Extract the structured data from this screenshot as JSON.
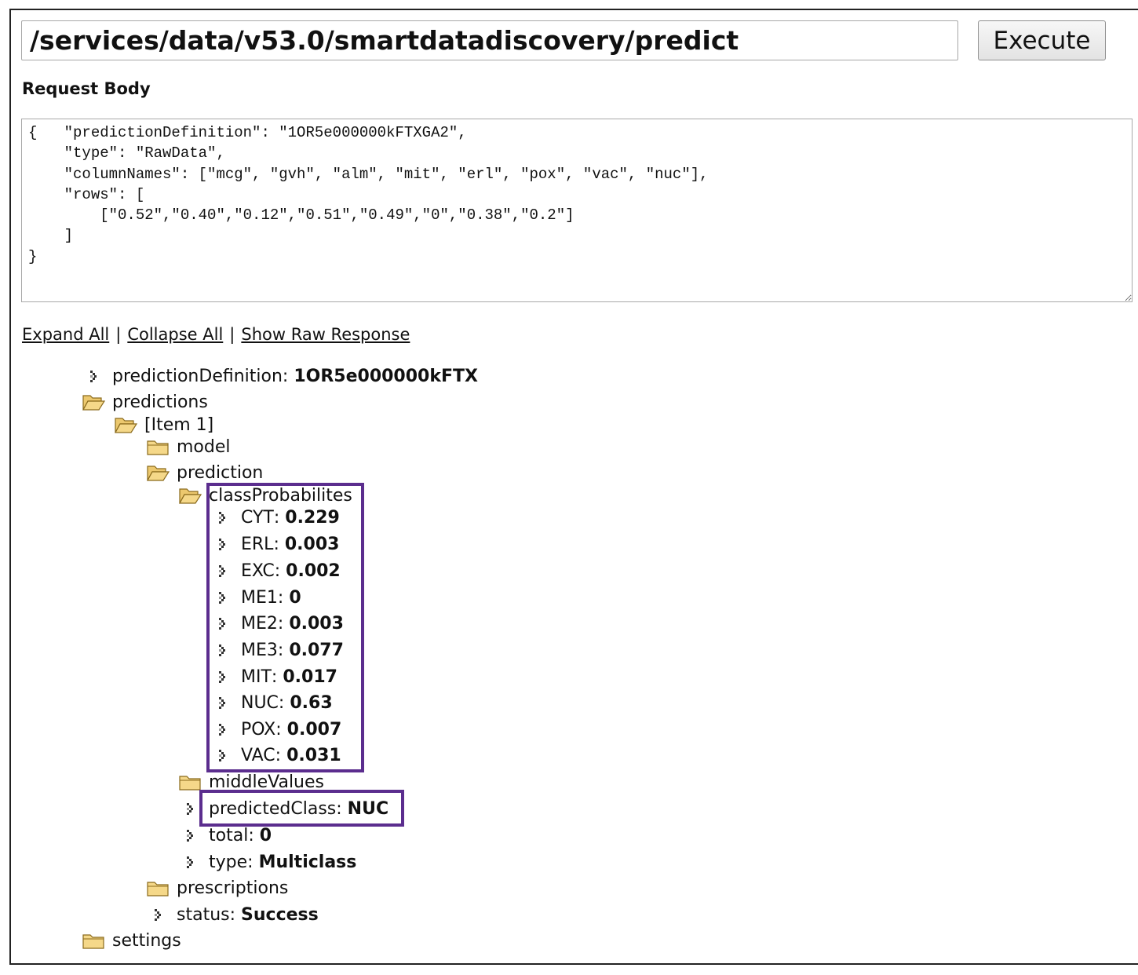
{
  "request": {
    "url": "/services/data/v53.0/smartdatadiscovery/predict",
    "execute_label": "Execute",
    "body_label": "Request Body",
    "body_text": "{   \"predictionDefinition\": \"1OR5e000000kFTXGA2\",\n    \"type\": \"RawData\",\n    \"columnNames\": [\"mcg\", \"gvh\", \"alm\", \"mit\", \"erl\", \"pox\", \"vac\", \"nuc\"],\n    \"rows\": [\n        [\"0.52\",\"0.40\",\"0.12\",\"0.51\",\"0.49\",\"0\",\"0.38\",\"0.2\"]\n    ]\n}"
  },
  "links": {
    "expand_all": "Expand All",
    "collapse_all": "Collapse All",
    "show_raw": "Show Raw Response",
    "separator": "|"
  },
  "tree": [
    {
      "kind": "leaf",
      "key": "predictionDefinition",
      "value": "1OR5e000000kFTX",
      "depth": 0
    },
    {
      "kind": "folder-open",
      "key": "predictions",
      "depth": 0
    },
    {
      "kind": "folder-open",
      "key": "[Item 1]",
      "depth": 1
    },
    {
      "kind": "folder-closed",
      "key": "model",
      "depth": 2
    },
    {
      "kind": "folder-open",
      "key": "prediction",
      "depth": 2
    },
    {
      "kind": "folder-open",
      "key": "classProbabilites",
      "depth": 3
    },
    {
      "kind": "leaf",
      "key": "CYT",
      "value": "0.229",
      "depth": 4
    },
    {
      "kind": "leaf",
      "key": "ERL",
      "value": "0.003",
      "depth": 4
    },
    {
      "kind": "leaf",
      "key": "EXC",
      "value": "0.002",
      "depth": 4
    },
    {
      "kind": "leaf",
      "key": "ME1",
      "value": "0",
      "depth": 4
    },
    {
      "kind": "leaf",
      "key": "ME2",
      "value": "0.003",
      "depth": 4
    },
    {
      "kind": "leaf",
      "key": "ME3",
      "value": "0.077",
      "depth": 4
    },
    {
      "kind": "leaf",
      "key": "MIT",
      "value": "0.017",
      "depth": 4
    },
    {
      "kind": "leaf",
      "key": "NUC",
      "value": "0.63",
      "depth": 4
    },
    {
      "kind": "leaf",
      "key": "POX",
      "value": "0.007",
      "depth": 4
    },
    {
      "kind": "leaf",
      "key": "VAC",
      "value": "0.031",
      "depth": 4
    },
    {
      "kind": "folder-closed",
      "key": "middleValues",
      "depth": 3
    },
    {
      "kind": "leaf",
      "key": "predictedClass",
      "value": "NUC",
      "depth": 3
    },
    {
      "kind": "leaf",
      "key": "total",
      "value": "0",
      "depth": 3
    },
    {
      "kind": "leaf",
      "key": "type",
      "value": "Multiclass",
      "depth": 3
    },
    {
      "kind": "folder-closed",
      "key": "prescriptions",
      "depth": 2
    },
    {
      "kind": "leaf",
      "key": "status",
      "value": "Success",
      "depth": 2
    },
    {
      "kind": "folder-closed",
      "key": "settings",
      "depth": 0
    }
  ],
  "colors": {
    "highlight": "#5b2d8e",
    "folder_fill": "#f5d889",
    "folder_stroke": "#8a6a1c"
  }
}
